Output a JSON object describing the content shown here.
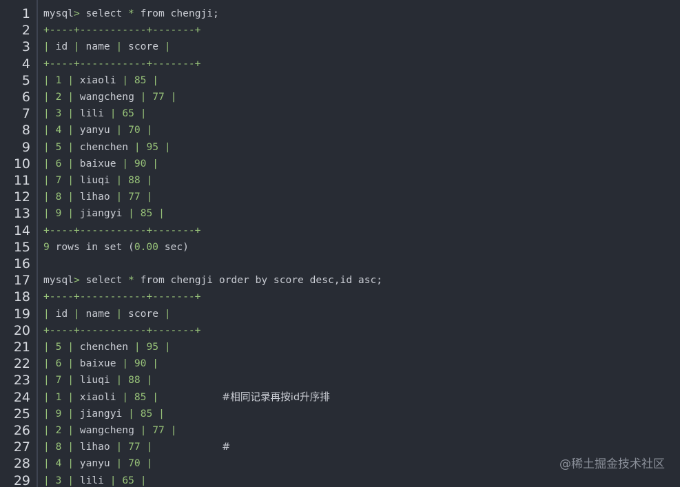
{
  "lines": [
    {
      "n": "1",
      "segments": [
        {
          "t": "mysql",
          "c": "kw"
        },
        {
          "t": ">",
          "c": "op"
        },
        {
          "t": " select ",
          "c": "kw"
        },
        {
          "t": "*",
          "c": "op"
        },
        {
          "t": " from chengji;",
          "c": "kw"
        }
      ]
    },
    {
      "n": "2",
      "segments": [
        {
          "t": "+----+-----------+-------+",
          "c": "border"
        }
      ]
    },
    {
      "n": "3",
      "segments": [
        {
          "t": "|",
          "c": "pipe"
        },
        {
          "t": " id ",
          "c": "kw"
        },
        {
          "t": "|",
          "c": "pipe"
        },
        {
          "t": " name      ",
          "c": "kw"
        },
        {
          "t": "|",
          "c": "pipe"
        },
        {
          "t": " score ",
          "c": "kw"
        },
        {
          "t": "|",
          "c": "pipe"
        }
      ]
    },
    {
      "n": "4",
      "segments": [
        {
          "t": "+----+-----------+-------+",
          "c": "border"
        }
      ]
    },
    {
      "n": "5",
      "row": [
        "1",
        "xiaoli",
        "85"
      ]
    },
    {
      "n": "6",
      "row": [
        "2",
        "wangcheng",
        "77"
      ]
    },
    {
      "n": "7",
      "row": [
        "3",
        "lili",
        "65"
      ]
    },
    {
      "n": "8",
      "row": [
        "4",
        "yanyu",
        "70"
      ]
    },
    {
      "n": "9",
      "row": [
        "5",
        "chenchen",
        "95"
      ]
    },
    {
      "n": "10",
      "row": [
        "6",
        "baixue",
        "90"
      ]
    },
    {
      "n": "11",
      "row": [
        "7",
        "liuqi",
        "88"
      ]
    },
    {
      "n": "12",
      "row": [
        "8",
        "lihao",
        "77"
      ]
    },
    {
      "n": "13",
      "row": [
        "9",
        "jiangyi",
        "85"
      ]
    },
    {
      "n": "14",
      "segments": [
        {
          "t": "+----+-----------+-------+",
          "c": "border"
        }
      ]
    },
    {
      "n": "15",
      "segments": [
        {
          "t": "9",
          "c": "num"
        },
        {
          "t": " rows in set (",
          "c": "kw"
        },
        {
          "t": "0.00",
          "c": "num"
        },
        {
          "t": " sec)",
          "c": "kw"
        }
      ]
    },
    {
      "n": "16",
      "segments": []
    },
    {
      "n": "17",
      "segments": [
        {
          "t": "mysql",
          "c": "kw"
        },
        {
          "t": ">",
          "c": "op"
        },
        {
          "t": " select ",
          "c": "kw"
        },
        {
          "t": "*",
          "c": "op"
        },
        {
          "t": " from chengji order by score desc,id asc;",
          "c": "kw"
        }
      ]
    },
    {
      "n": "18",
      "segments": [
        {
          "t": "+----+-----------+-------+",
          "c": "border"
        }
      ]
    },
    {
      "n": "19",
      "segments": [
        {
          "t": "|",
          "c": "pipe"
        },
        {
          "t": " id ",
          "c": "kw"
        },
        {
          "t": "|",
          "c": "pipe"
        },
        {
          "t": " name      ",
          "c": "kw"
        },
        {
          "t": "|",
          "c": "pipe"
        },
        {
          "t": " score ",
          "c": "kw"
        },
        {
          "t": "|",
          "c": "pipe"
        }
      ]
    },
    {
      "n": "20",
      "segments": [
        {
          "t": "+----+-----------+-------+",
          "c": "border"
        }
      ]
    },
    {
      "n": "21",
      "row": [
        "5",
        "chenchen",
        "95"
      ]
    },
    {
      "n": "22",
      "row": [
        "6",
        "baixue",
        "90"
      ]
    },
    {
      "n": "23",
      "row": [
        "7",
        "liuqi",
        "88"
      ]
    },
    {
      "n": "24",
      "row": [
        "1",
        "xiaoli",
        "85"
      ],
      "comment": "#相同记录再按id升序排"
    },
    {
      "n": "25",
      "row": [
        "9",
        "jiangyi",
        "85"
      ]
    },
    {
      "n": "26",
      "row": [
        "2",
        "wangcheng",
        "77"
      ]
    },
    {
      "n": "27",
      "row": [
        "8",
        "lihao",
        "77"
      ],
      "comment": "#"
    },
    {
      "n": "28",
      "row": [
        "4",
        "yanyu",
        "70"
      ]
    },
    {
      "n": "29",
      "row": [
        "3",
        "lili",
        "65"
      ]
    }
  ],
  "watermark": "@稀土掘金技术社区",
  "colors": {
    "background": "#282c34",
    "text": "#c9ccd3",
    "green": "#98c379",
    "line_number": "#d7dae0"
  }
}
